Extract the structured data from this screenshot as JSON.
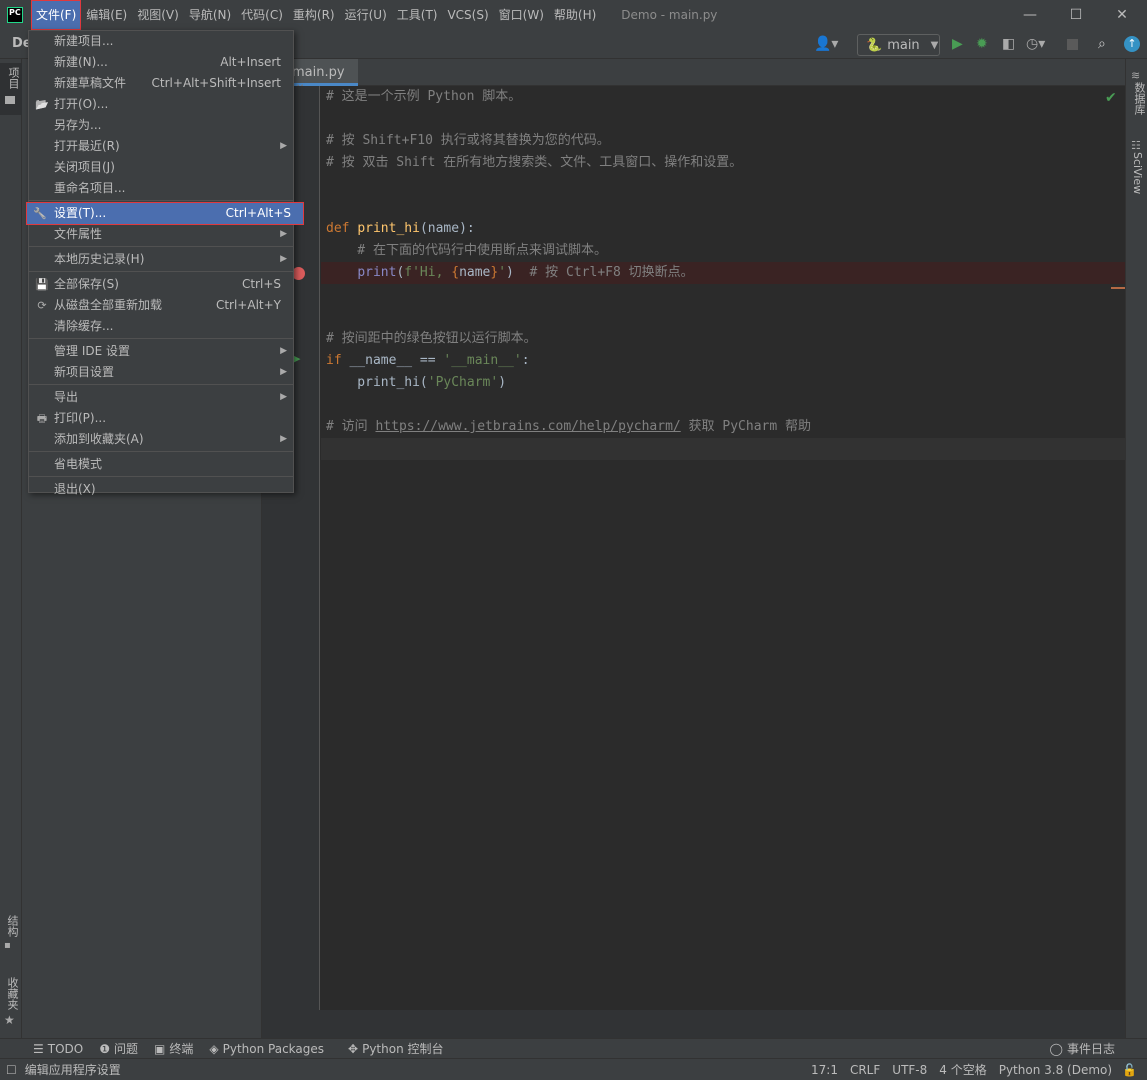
{
  "app": {
    "logo_text": "PC",
    "window_title": "Demo - main.py",
    "project_name": "De"
  },
  "menubar": [
    "文件(F)",
    "编辑(E)",
    "视图(V)",
    "导航(N)",
    "代码(C)",
    "重构(R)",
    "运行(U)",
    "工具(T)",
    "VCS(S)",
    "窗口(W)",
    "帮助(H)"
  ],
  "window_controls": {
    "minimize": "—",
    "maximize": "☐",
    "close": "✕"
  },
  "toolbar": {
    "run_config": "main",
    "icons": [
      "user-icon",
      "python-icon",
      "run-icon",
      "debug-icon",
      "coverage-icon",
      "profile-icon",
      "stop-icon",
      "search-icon",
      "update-icon"
    ],
    "run_color": "#499c54"
  },
  "left_strip": {
    "project": "项目",
    "structure": "结构",
    "favorites": "收藏夹"
  },
  "right_strip": {
    "database": "数据库",
    "sciview": "SciView"
  },
  "editor": {
    "tab": "main.py",
    "tab_close": "✕",
    "lines": [
      [
        [
          "comment",
          "# 这是一个示例 Python 脚本。"
        ]
      ],
      [],
      [
        [
          "comment",
          "# 按 Shift+F10 执行或将其替换为您的代码。"
        ]
      ],
      [
        [
          "comment",
          "# 按 双击 Shift 在所有地方搜索类、文件、工具窗口、操作和设置。"
        ]
      ],
      [],
      [],
      [
        [
          "kw",
          "def "
        ],
        [
          "fn",
          "print_hi"
        ],
        [
          "plain",
          "(name):"
        ]
      ],
      [
        [
          "comment",
          "    # 在下面的代码行中使用断点来调试脚本。"
        ]
      ],
      [
        [
          "plain",
          "    "
        ],
        [
          "builtin",
          "print"
        ],
        [
          "plain",
          "("
        ],
        [
          "str",
          "f'Hi, "
        ],
        [
          "brace",
          "{"
        ],
        [
          "plain",
          "name"
        ],
        [
          "brace",
          "}"
        ],
        [
          "str",
          "'"
        ],
        [
          "plain",
          ")  "
        ],
        [
          "comment",
          "# 按 Ctrl+F8 切换断点。"
        ]
      ],
      [],
      [],
      [
        [
          "comment",
          "# 按间距中的绿色按钮以运行脚本。"
        ]
      ],
      [
        [
          "kw",
          "if "
        ],
        [
          "plain",
          "__name__ == "
        ],
        [
          "str",
          "'__main__'"
        ],
        [
          "plain",
          ":"
        ]
      ],
      [
        [
          "plain",
          "    print_hi("
        ],
        [
          "str",
          "'PyCharm'"
        ],
        [
          "plain",
          ")"
        ]
      ],
      [],
      [
        [
          "comment",
          "# 访问 "
        ],
        [
          "link",
          "https://www.jetbrains.com/help/pycharm/"
        ],
        [
          "comment",
          " 获取 PyCharm 帮助"
        ]
      ],
      []
    ],
    "breakpoint_line": 9,
    "current_line": 17,
    "run_gutter_line": 13,
    "inspection_status": "ok"
  },
  "file_menu": [
    {
      "label": "新建项目..."
    },
    {
      "label": "新建(N)...",
      "shortcut": "Alt+Insert"
    },
    {
      "label": "新建草稿文件",
      "shortcut": "Ctrl+Alt+Shift+Insert"
    },
    {
      "label": "打开(O)...",
      "icon": "folder-open-icon"
    },
    {
      "label": "另存为..."
    },
    {
      "label": "打开最近(R)",
      "submenu": true
    },
    {
      "label": "关闭项目(J)"
    },
    {
      "label": "重命名项目..."
    },
    {
      "sep": true
    },
    {
      "label": "设置(T)...",
      "shortcut": "Ctrl+Alt+S",
      "icon": "wrench-icon",
      "selected": true
    },
    {
      "label": "文件属性",
      "submenu": true
    },
    {
      "sep": true
    },
    {
      "label": "本地历史记录(H)",
      "submenu": true
    },
    {
      "sep": true
    },
    {
      "label": "全部保存(S)",
      "shortcut": "Ctrl+S",
      "icon": "save-icon"
    },
    {
      "label": "从磁盘全部重新加载",
      "shortcut": "Ctrl+Alt+Y",
      "icon": "reload-icon"
    },
    {
      "label": "清除缓存..."
    },
    {
      "sep": true
    },
    {
      "label": "管理 IDE 设置",
      "submenu": true
    },
    {
      "label": "新项目设置",
      "submenu": true
    },
    {
      "sep": true
    },
    {
      "label": "导出",
      "submenu": true
    },
    {
      "label": "打印(P)...",
      "icon": "print-icon"
    },
    {
      "label": "添加到收藏夹(A)",
      "submenu": true
    },
    {
      "sep": true
    },
    {
      "label": "省电模式"
    },
    {
      "sep": true
    },
    {
      "label": "退出(X)"
    }
  ],
  "tool_windows": [
    "TODO",
    "问题",
    "终端",
    "Python Packages",
    "Python 控制台"
  ],
  "event_log": "事件日志",
  "status": {
    "message": "编辑应用程序设置",
    "position": "17:1",
    "line_sep": "CRLF",
    "encoding": "UTF-8",
    "indent": "4 个空格",
    "interpreter": "Python 3.8 (Demo)"
  }
}
